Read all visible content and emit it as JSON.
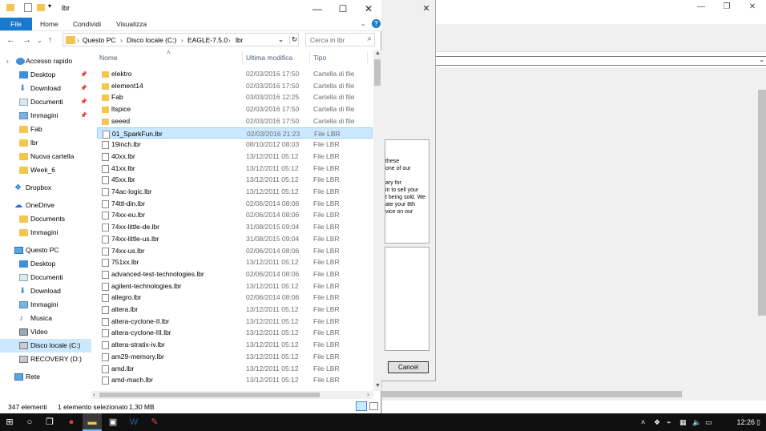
{
  "explorer": {
    "title": "lbr",
    "ribbon_tabs": [
      "File",
      "Home",
      "Condividi",
      "Visualizza"
    ],
    "address": {
      "parts": [
        "Questo PC",
        "Disco locale (C:)",
        "EAGLE-7.5.0",
        "lbr"
      ]
    },
    "search_placeholder": "Cerca in lbr",
    "columns": {
      "name": "Nome",
      "date": "Ultima modifica",
      "type": "Tipo"
    },
    "nav": {
      "quick_access": "Accesso rapido",
      "quick_items": [
        "Desktop",
        "Download",
        "Documenti",
        "Immagini",
        "Fab",
        "lbr",
        "Nuova cartella",
        "Week_6"
      ],
      "dropbox": "Dropbox",
      "onedrive": "OneDrive",
      "onedrive_items": [
        "Documents",
        "Immagini"
      ],
      "this_pc": "Questo PC",
      "pc_items": [
        "Desktop",
        "Documenti",
        "Download",
        "Immagini",
        "Musica",
        "Video",
        "Disco locale (C:)",
        "RECOVERY (D:)"
      ],
      "network": "Rete"
    },
    "files": [
      {
        "name": "elektro",
        "date": "02/03/2016 17:50",
        "type": "Cartella di file",
        "kind": "folder"
      },
      {
        "name": "element14",
        "date": "02/03/2016 17:50",
        "type": "Cartella di file",
        "kind": "folder"
      },
      {
        "name": "Fab",
        "date": "03/03/2016 12:25",
        "type": "Cartella di file",
        "kind": "folder"
      },
      {
        "name": "ltspice",
        "date": "02/03/2016 17:50",
        "type": "Cartella di file",
        "kind": "folder"
      },
      {
        "name": "seeed",
        "date": "02/03/2016 17:50",
        "type": "Cartella di file",
        "kind": "folder"
      },
      {
        "name": "01_SparkFun.lbr",
        "date": "02/03/2016 21:23",
        "type": "File LBR",
        "kind": "file",
        "selected": true
      },
      {
        "name": "19inch.lbr",
        "date": "08/10/2012 08:03",
        "type": "File LBR",
        "kind": "file"
      },
      {
        "name": "40xx.lbr",
        "date": "13/12/2011 05:12",
        "type": "File LBR",
        "kind": "file"
      },
      {
        "name": "41xx.lbr",
        "date": "13/12/2011 05:12",
        "type": "File LBR",
        "kind": "file"
      },
      {
        "name": "45xx.lbr",
        "date": "13/12/2011 05:12",
        "type": "File LBR",
        "kind": "file"
      },
      {
        "name": "74ac-logic.lbr",
        "date": "13/12/2011 05:12",
        "type": "File LBR",
        "kind": "file"
      },
      {
        "name": "74ttl-din.lbr",
        "date": "02/06/2014 08:06",
        "type": "File LBR",
        "kind": "file"
      },
      {
        "name": "74xx-eu.lbr",
        "date": "02/06/2014 08:06",
        "type": "File LBR",
        "kind": "file"
      },
      {
        "name": "74xx-little-de.lbr",
        "date": "31/08/2015 09:04",
        "type": "File LBR",
        "kind": "file"
      },
      {
        "name": "74xx-little-us.lbr",
        "date": "31/08/2015 09:04",
        "type": "File LBR",
        "kind": "file"
      },
      {
        "name": "74xx-us.lbr",
        "date": "02/06/2014 08:06",
        "type": "File LBR",
        "kind": "file"
      },
      {
        "name": "751xx.lbr",
        "date": "13/12/2011 05:12",
        "type": "File LBR",
        "kind": "file"
      },
      {
        "name": "advanced-test-technologies.lbr",
        "date": "02/06/2014 08:06",
        "type": "File LBR",
        "kind": "file"
      },
      {
        "name": "agilent-technologies.lbr",
        "date": "13/12/2011 05:12",
        "type": "File LBR",
        "kind": "file"
      },
      {
        "name": "allegro.lbr",
        "date": "02/06/2014 08:06",
        "type": "File LBR",
        "kind": "file"
      },
      {
        "name": "altera.lbr",
        "date": "13/12/2011 05:12",
        "type": "File LBR",
        "kind": "file"
      },
      {
        "name": "altera-cyclone-II.lbr",
        "date": "13/12/2011 05:12",
        "type": "File LBR",
        "kind": "file"
      },
      {
        "name": "altera-cyclone-III.lbr",
        "date": "13/12/2011 05:12",
        "type": "File LBR",
        "kind": "file"
      },
      {
        "name": "altera-stratix-iv.lbr",
        "date": "13/12/2011 05:12",
        "type": "File LBR",
        "kind": "file"
      },
      {
        "name": "am29-memory.lbr",
        "date": "13/12/2011 05:12",
        "type": "File LBR",
        "kind": "file"
      },
      {
        "name": "amd.lbr",
        "date": "13/12/2011 05:12",
        "type": "File LBR",
        "kind": "file"
      },
      {
        "name": "amd-mach.lbr",
        "date": "13/12/2011 05:12",
        "type": "File LBR",
        "kind": "file"
      }
    ],
    "status": {
      "count": "347 elementi",
      "selection": "1 elemento selezionato",
      "size": "1,30 MB"
    }
  },
  "dialog": {
    "text_lines": [
      "these",
      "one of our",
      "",
      "ary for",
      "in to sell your",
      "t being sold. We",
      "ate your 8th",
      "vice on our"
    ],
    "cancel": "Cancel"
  },
  "taskbar": {
    "time": "12:26"
  },
  "colors": {
    "accent": "#1979ca",
    "selection": "#cce8ff",
    "folder": "#f4c650"
  },
  "icons": [
    "back-arrow-icon",
    "forward-arrow-icon",
    "up-arrow-icon",
    "refresh-icon",
    "search-icon",
    "folder-icon",
    "file-icon",
    "pin-icon",
    "windows-start-icon",
    "cortana-icon",
    "task-view-icon",
    "chrome-icon",
    "file-explorer-icon",
    "store-icon",
    "word-icon",
    "app-icon"
  ]
}
